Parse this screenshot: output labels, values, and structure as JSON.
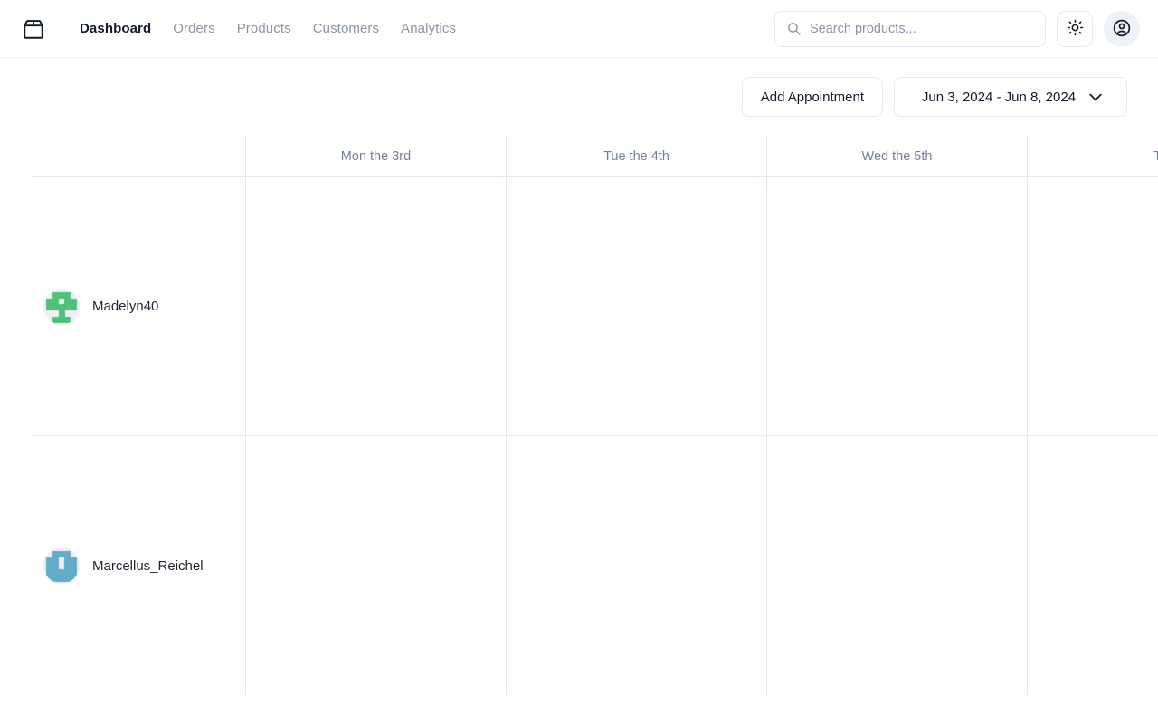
{
  "header": {
    "logo_icon": "package-icon",
    "nav": [
      {
        "label": "Dashboard",
        "active": true
      },
      {
        "label": "Orders",
        "active": false
      },
      {
        "label": "Products",
        "active": false
      },
      {
        "label": "Customers",
        "active": false
      },
      {
        "label": "Analytics",
        "active": false
      }
    ],
    "search": {
      "placeholder": "Search products...",
      "value": "",
      "icon": "search-icon"
    },
    "theme_toggle_icon": "sun-icon",
    "account_icon": "user-circle-icon"
  },
  "toolbar": {
    "add_appointment_label": "Add Appointment",
    "date_range_label": "Jun 3, 2024 - Jun 8, 2024",
    "date_range_icon": "chevron-down-icon"
  },
  "scheduler": {
    "resource_header": "",
    "days": [
      {
        "label": "Mon the 3rd"
      },
      {
        "label": "Tue the 4th"
      },
      {
        "label": "Wed the 5th"
      },
      {
        "label": "T"
      }
    ],
    "resources": [
      {
        "name": "Madelyn40",
        "avatar_color": "#4ec27a",
        "avatar_bg": "#f0f0f0",
        "avatar_seed": "madelyn40"
      },
      {
        "name": "Marcellus_Reichel",
        "avatar_color": "#62acca",
        "avatar_bg": "#eeeeee",
        "avatar_seed": "marcellus_reichel"
      }
    ]
  },
  "colors": {
    "border": "#e3e9f0",
    "header_border": "#eef1f6",
    "text_primary": "#1e2433",
    "text_muted": "#76809a",
    "nav_inactive": "#8d95a5"
  }
}
